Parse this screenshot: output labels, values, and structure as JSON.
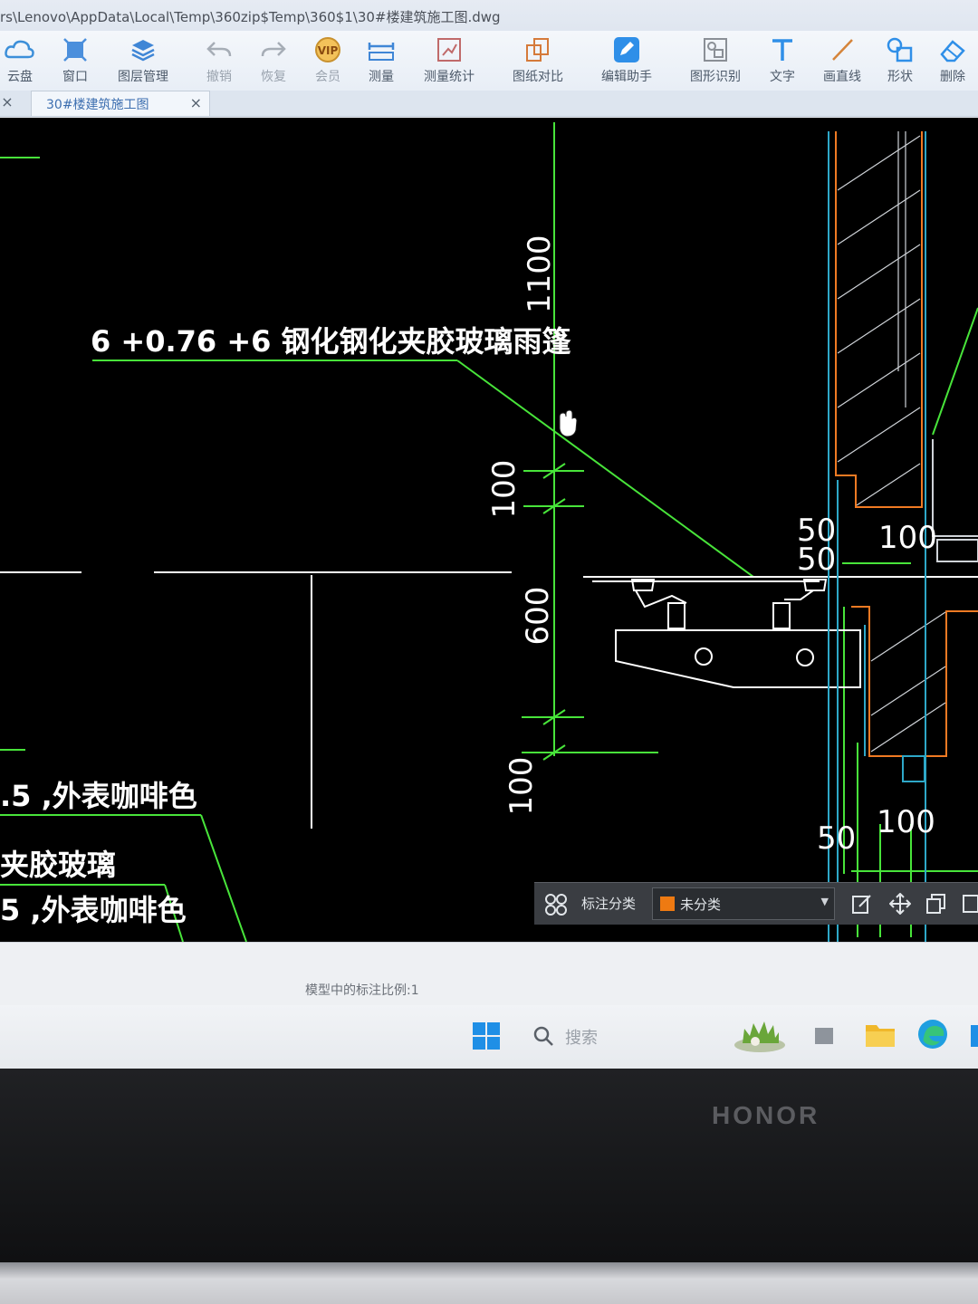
{
  "window": {
    "title": "rs\\Lenovo\\AppData\\Local\\Temp\\360zip$Temp\\360$1\\30#楼建筑施工图.dwg"
  },
  "toolbar": {
    "items": [
      {
        "label": "云盘",
        "icon": "cloud-icon"
      },
      {
        "label": "窗口",
        "icon": "window-icon"
      },
      {
        "label": "图层管理",
        "icon": "layers-icon"
      },
      {
        "label": "撤销",
        "icon": "undo-icon"
      },
      {
        "label": "恢复",
        "icon": "redo-icon"
      },
      {
        "label": "会员",
        "icon": "vip-icon"
      },
      {
        "label": "测量",
        "icon": "ruler-icon"
      },
      {
        "label": "测量统计",
        "icon": "measure-stats-icon"
      },
      {
        "label": "图纸对比",
        "icon": "compare-icon"
      },
      {
        "label": "编辑助手",
        "icon": "edit-assistant-icon"
      },
      {
        "label": "图形识别",
        "icon": "shape-recognition-icon"
      },
      {
        "label": "文字",
        "icon": "text-icon"
      },
      {
        "label": "画直线",
        "icon": "line-icon"
      },
      {
        "label": "形状",
        "icon": "shapes-icon"
      },
      {
        "label": "删除",
        "icon": "eraser-icon"
      }
    ]
  },
  "tabs": {
    "active_label": "30#楼建筑施工图",
    "close_glyph": "×"
  },
  "drawing": {
    "canopy_label": "6 +0.76 +6 钢化钢化夹胶玻璃雨篷",
    "left_label_1": ".5 ,外表咖啡色",
    "left_label_2": "夹胶玻璃",
    "left_label_3": "5 ,外表咖啡色",
    "dims": {
      "d1100": "1100",
      "d100_upper": "100",
      "d600": "600",
      "d100_lower": "100",
      "d50_a": "50",
      "d50_b": "50",
      "d100_right_upper": "100",
      "d50_lower": "50",
      "d100_right_lower": "100"
    }
  },
  "annotation_bar": {
    "label": "标注分类",
    "selected": "未分类",
    "selected_color": "#ee7a12"
  },
  "status": {
    "text": "模型中的标注比例:1"
  },
  "taskbar": {
    "search_placeholder": "搜索"
  },
  "device": {
    "brand": "HONOR"
  }
}
